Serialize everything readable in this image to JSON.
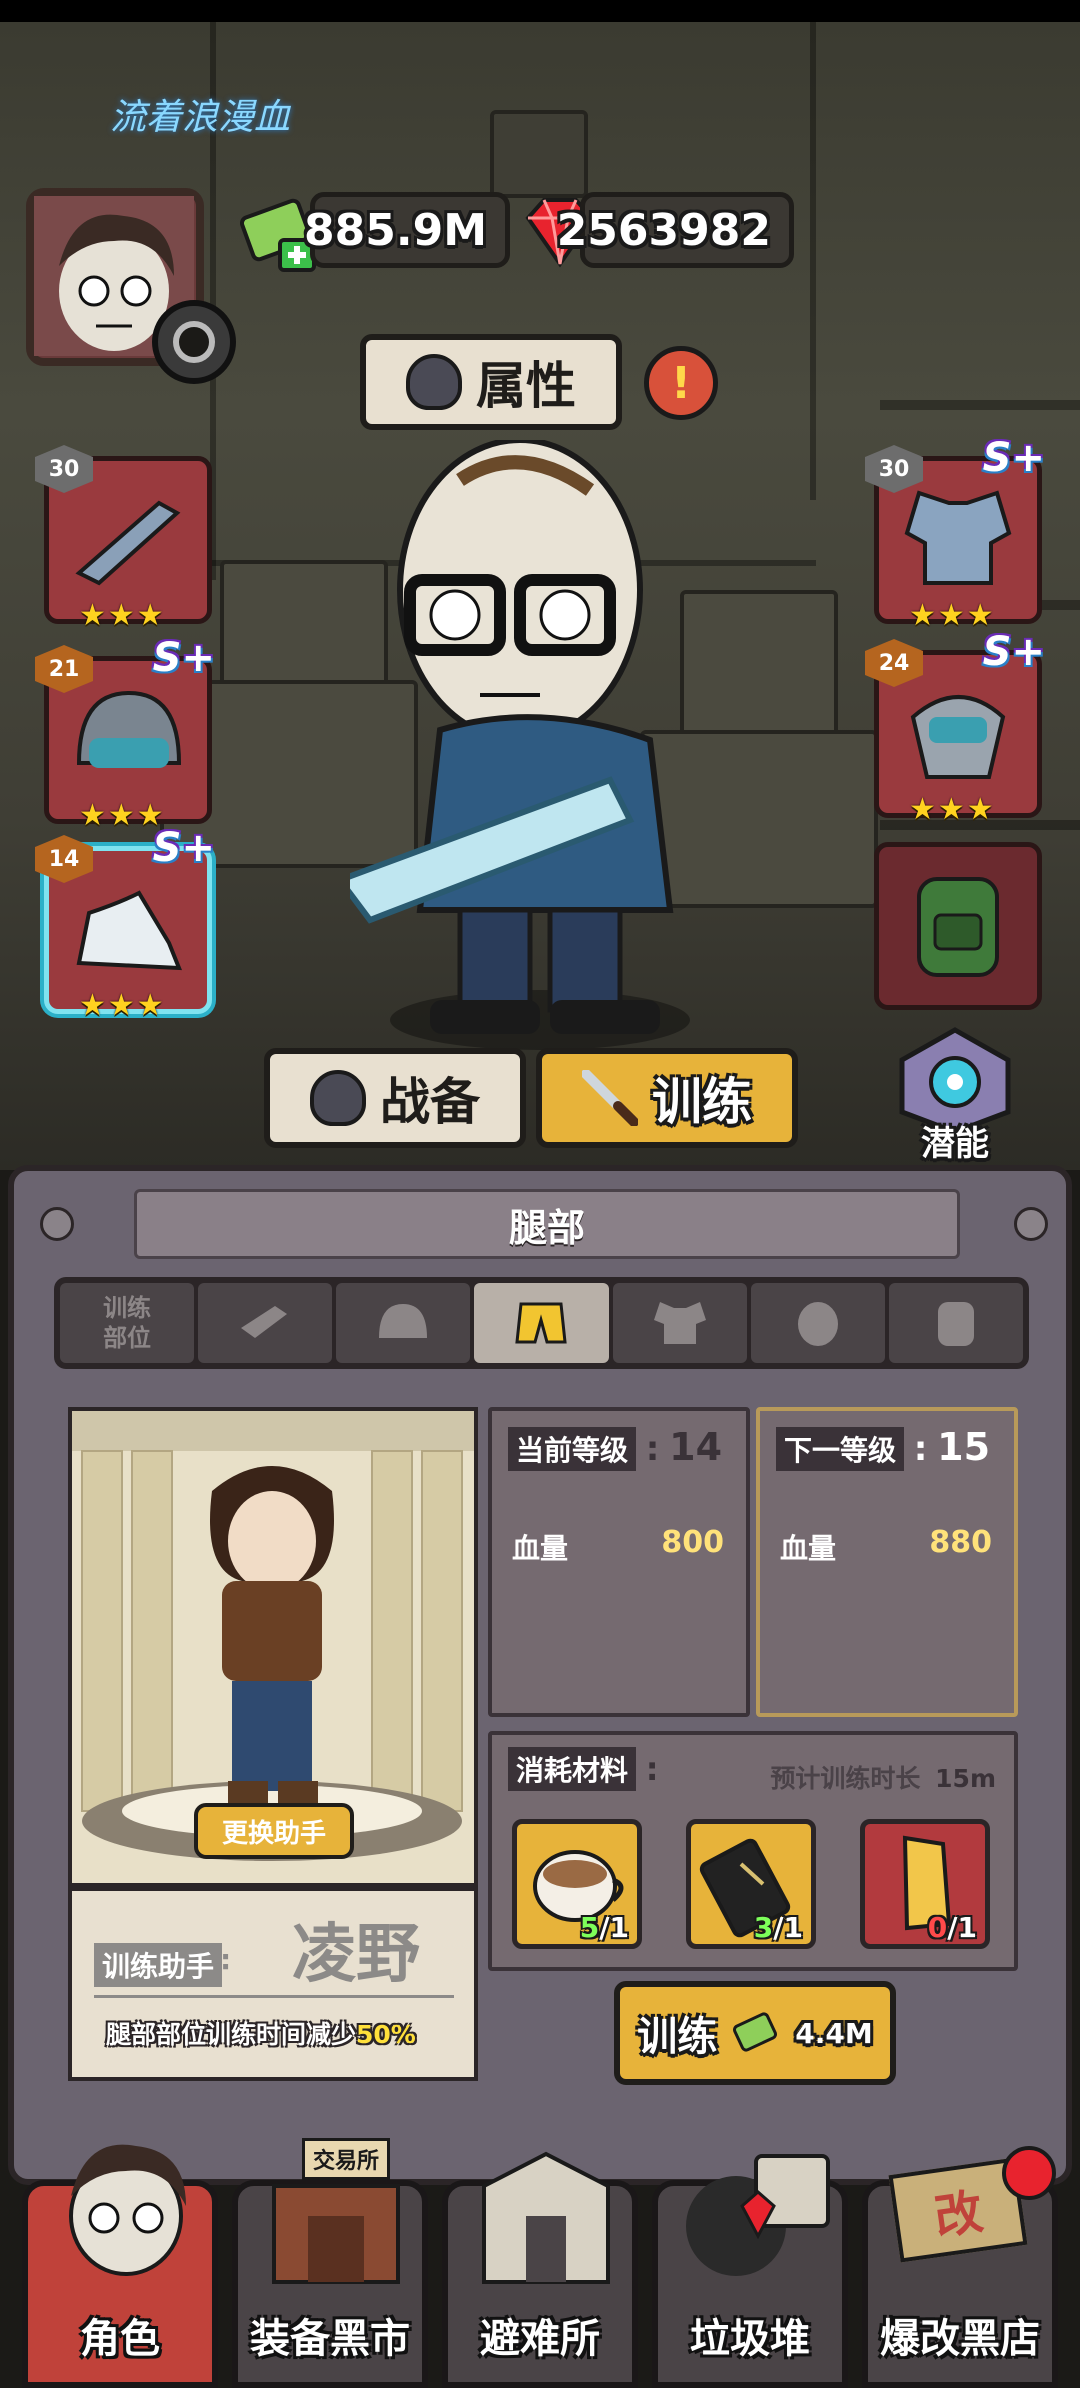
{
  "scroll_banner": "流着浪漫血",
  "currencies": {
    "cash": "885.9M",
    "gems": "2563982"
  },
  "attributes_button": "属性",
  "alert_mark": "!",
  "left_slots": [
    {
      "level": "30",
      "grade": "",
      "stars": "★★★",
      "item": "weapon"
    },
    {
      "level": "21",
      "grade": "S+",
      "stars": "★★★",
      "item": "helmet"
    },
    {
      "level": "14",
      "grade": "S+",
      "stars": "★★★",
      "item": "shoes",
      "selected": true
    }
  ],
  "right_slots": [
    {
      "level": "30",
      "grade": "S+",
      "stars": "★★★",
      "item": "armor"
    },
    {
      "level": "24",
      "grade": "S+",
      "stars": "★★★",
      "item": "mask"
    },
    {
      "level": "",
      "grade": "",
      "stars": "",
      "item": "backpack"
    }
  ],
  "mode_buttons": {
    "gear": "战备",
    "train": "训练"
  },
  "potential_label": "潜能",
  "panel": {
    "title": "腿部",
    "tab_label": "训练部位",
    "tabs": [
      "weapon-icon",
      "helmet-icon",
      "pants-icon",
      "armor-icon",
      "mask-icon",
      "backpack-icon"
    ],
    "change_assistant": "更换助手",
    "assistant_label": "训练助手",
    "assistant_name": "凌野",
    "assistant_bonus_text": "腿部部位训练时间减少",
    "assistant_bonus_value": "50%",
    "current_level_label": "当前等级",
    "current_level": "14",
    "next_level_label": "下一等级",
    "next_level": "15",
    "hp_label": "血量",
    "hp_current": "800",
    "hp_next": "880",
    "materials_label": "消耗材料",
    "duration_label": "预计训练时长",
    "duration_value": "15m",
    "materials": [
      {
        "name": "coffee",
        "have": "5",
        "need": "/1",
        "ok": true
      },
      {
        "name": "card",
        "have": "3",
        "need": "/1",
        "ok": true
      },
      {
        "name": "gold-bar",
        "have": "0",
        "need": "/1",
        "ok": false
      }
    ],
    "train_button": "训练",
    "train_cost": "4.4M"
  },
  "nav": [
    {
      "label": "角色",
      "active": true
    },
    {
      "label": "装备黑市",
      "sign": "交易所"
    },
    {
      "label": "避难所"
    },
    {
      "label": "垃圾堆"
    },
    {
      "label": "爆改黑店",
      "sign": "改"
    }
  ],
  "colors": {
    "gold": "#e7b33a",
    "slot_red": "#9a3a3e",
    "panel": "#6b6470",
    "value_yellow": "#ffe27a",
    "ok_green": "#7dff5a",
    "bad_red": "#ff4a4a"
  }
}
